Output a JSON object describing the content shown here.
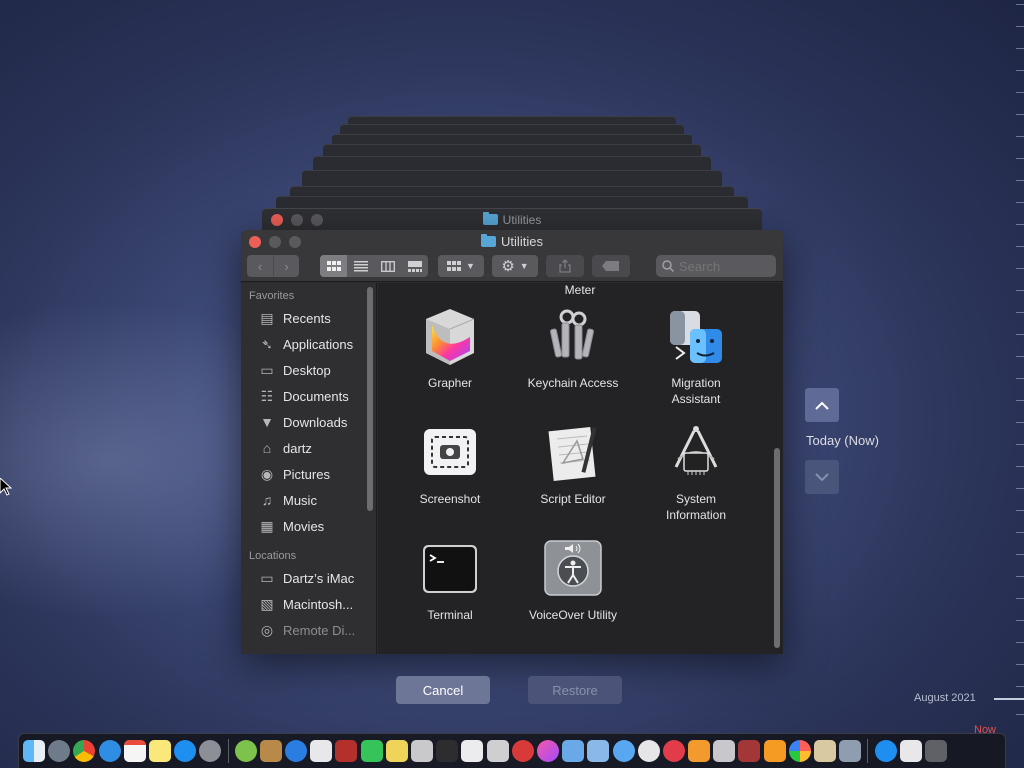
{
  "window": {
    "title": "Utilities",
    "back_title": "Utilities"
  },
  "toolbar": {
    "search_placeholder": "Search"
  },
  "sidebar": {
    "favorites_header": "Favorites",
    "locations_header": "Locations",
    "favorites": [
      {
        "label": "Recents",
        "icon": "recents-icon"
      },
      {
        "label": "Applications",
        "icon": "applications-icon"
      },
      {
        "label": "Desktop",
        "icon": "desktop-icon"
      },
      {
        "label": "Documents",
        "icon": "documents-icon"
      },
      {
        "label": "Downloads",
        "icon": "downloads-icon"
      },
      {
        "label": "dartz",
        "icon": "home-icon"
      },
      {
        "label": "Pictures",
        "icon": "pictures-icon"
      },
      {
        "label": "Music",
        "icon": "music-icon"
      },
      {
        "label": "Movies",
        "icon": "movies-icon"
      }
    ],
    "locations": [
      {
        "label": "Dartz’s iMac",
        "icon": "imac-icon"
      },
      {
        "label": "Macintosh...",
        "icon": "disk-icon"
      },
      {
        "label": "Remote Di...",
        "icon": "remote-disc-icon"
      }
    ]
  },
  "content": {
    "partial_label": "Meter",
    "apps": [
      {
        "label": "Grapher",
        "icon": "grapher-icon"
      },
      {
        "label": "Keychain Access",
        "icon": "keychain-icon"
      },
      {
        "label": "Migration\nAssistant",
        "icon": "migration-assistant-icon"
      },
      {
        "label": "Screenshot",
        "icon": "screenshot-icon"
      },
      {
        "label": "Script Editor",
        "icon": "script-editor-icon"
      },
      {
        "label": "System\nInformation",
        "icon": "system-information-icon"
      },
      {
        "label": "Terminal",
        "icon": "terminal-icon"
      },
      {
        "label": "VoiceOver Utility",
        "icon": "voiceover-utility-icon"
      }
    ]
  },
  "time_machine": {
    "current_label": "Today (Now)",
    "cancel_label": "Cancel",
    "restore_label": "Restore",
    "timeline_month": "August 2021",
    "timeline_now": "Now"
  },
  "colors": {
    "close_red": "#ec5f57",
    "accent_blue": "#58a6d8",
    "tm_button_active": "#5f6b96",
    "timeline_now": "#e05050"
  }
}
